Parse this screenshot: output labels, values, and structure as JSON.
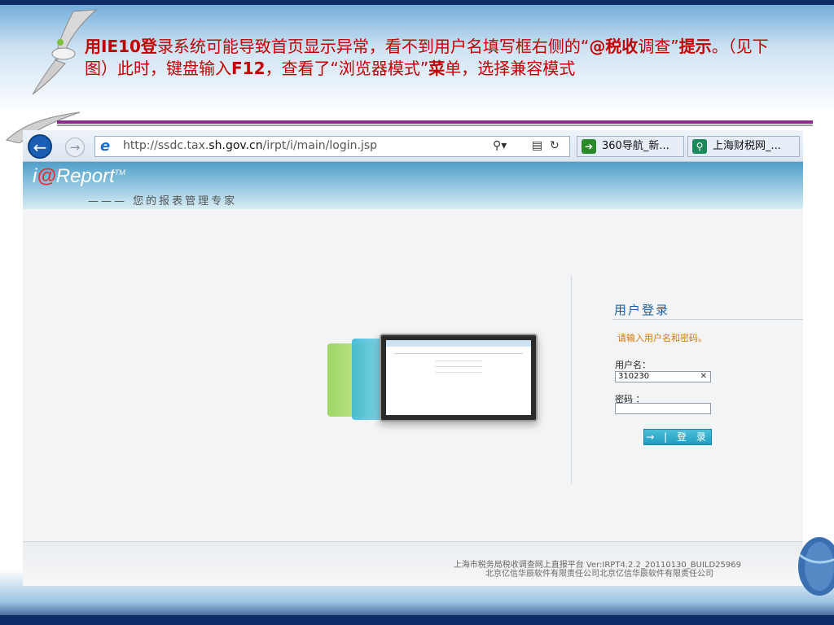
{
  "slide": {
    "instruction_parts": [
      {
        "text": "用IE10登",
        "bold": true
      },
      {
        "text": "录系统可能导致首页显示异常，看不到用户名填写框右侧的“",
        "bold": false
      },
      {
        "text": "@税收",
        "bold": true
      },
      {
        "text": "调查”",
        "bold": false
      },
      {
        "text": "提示",
        "bold": true
      },
      {
        "text": "。（见下图）此时，键盘输入",
        "bold": false
      },
      {
        "text": "F12",
        "bold": true
      },
      {
        "text": "，查看了“浏览器模式”",
        "bold": false
      },
      {
        "text": "菜",
        "bold": true
      },
      {
        "text": "单，选择兼容模式",
        "bold": false
      }
    ]
  },
  "browser": {
    "url_prefix": "http://ssdc.tax.",
    "url_domain": "sh.gov.cn",
    "url_suffix": "/irpt/i/main/login.jsp",
    "tabs": [
      {
        "label": "360导航_新...",
        "icon": "360-icon",
        "color": "#2a8a2a"
      },
      {
        "label": "上海财税网_...",
        "icon": "search-page-icon",
        "color": "#1a8a5a"
      }
    ]
  },
  "page": {
    "logo_text": "Report",
    "logo_prefix": "i",
    "logo_at": "@",
    "logo_tm": "TM",
    "slogan": "——— 您的报表管理专家",
    "login": {
      "title": "用户登录",
      "hint": "请输入用户名和密码。",
      "username_label": "用户名：",
      "username_value": "310230",
      "password_label": "密码 ：",
      "button_label": "→ | 登 录"
    },
    "footer": {
      "line1": "上海市税务局税收调查网上直报平台 Ver:IRPT4.2.2_20110130_BUILD25969",
      "line2": "北京亿信华辰软件有限责任公司北京亿信华辰软件有限责任公司"
    }
  },
  "colors": {
    "accent": "#1b5e9f",
    "instruction_text": "#c00000",
    "hint": "#d07a00",
    "login_button": "#1f9dc0"
  }
}
